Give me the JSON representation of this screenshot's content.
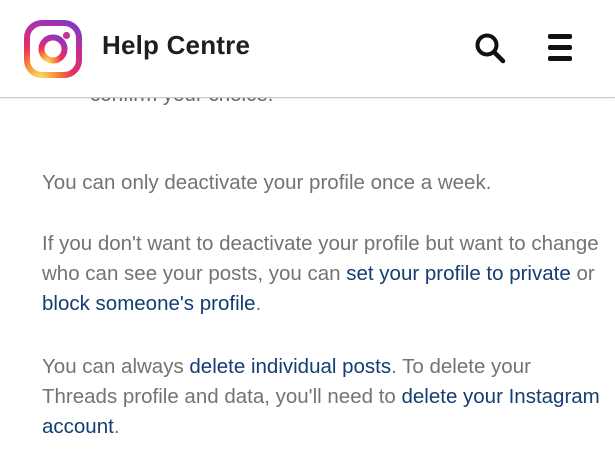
{
  "header": {
    "title": "Help Centre",
    "logo_icon": "instagram-logo-icon",
    "search_icon": "search-icon",
    "menu_icon": "hamburger-menu-icon"
  },
  "article": {
    "cut_off_line": "confirm your choice.",
    "p1": "You can only deactivate your profile once a week.",
    "p2": {
      "text1": "If you don't want to deactivate your profile but want to change who can see your posts, you can ",
      "link1": "set your profile to private",
      "text2": " or ",
      "link2": "block someone's profile",
      "text3": "."
    },
    "p3": {
      "text1": "You can always ",
      "link1": "delete individual posts",
      "text2": ". To delete your Threads profile and data, you'll need to ",
      "link2": "delete your Instagram account",
      "text3": "."
    }
  },
  "colors": {
    "link": "#143d73",
    "body_text": "#737373",
    "title": "#1c1e21"
  }
}
